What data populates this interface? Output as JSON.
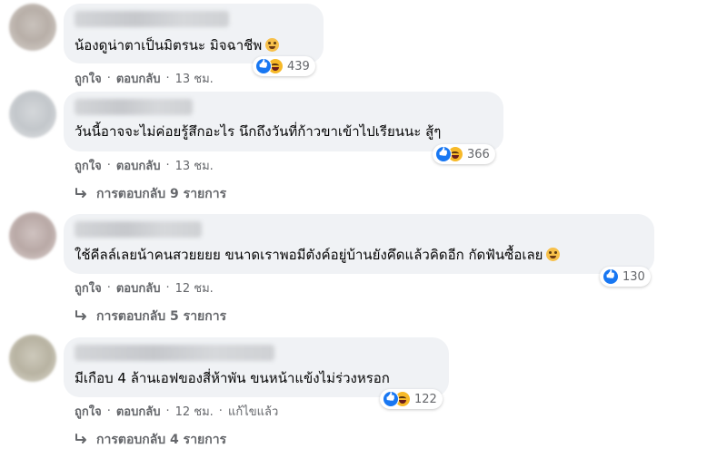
{
  "comments": [
    {
      "text": "น้องดูน่าตาเป็นมิตรนะ มิจฉาชีพ",
      "reaction_count": "439",
      "like_label": "ถูกใจ",
      "reply_label": "ตอบกลับ",
      "time": "13 ชม.",
      "edited": "",
      "replies": ""
    },
    {
      "text": "วันนี้อาจจะไม่ค่อยรู้สึกอะไร นึกถึงวันที่ก้าวขาเข้าไปเรียนนะ สู้ๆ",
      "reaction_count": "366",
      "like_label": "ถูกใจ",
      "reply_label": "ตอบกลับ",
      "time": "13 ชม.",
      "edited": "",
      "replies": "การตอบกลับ 9 รายการ"
    },
    {
      "text": "ใช้คีลล์เลยน้าคนสวยยยย ขนาดเราพอมีตังค์อยู่บ้านยังคึดแล้วคิดอีก กัดฟันซื้อเลย",
      "reaction_count": "130",
      "like_label": "ถูกใจ",
      "reply_label": "ตอบกลับ",
      "time": "12 ชม.",
      "edited": "",
      "replies": "การตอบกลับ 5 รายการ"
    },
    {
      "text": "มีเกือบ 4 ล้านเอฟของสี่ห้าพัน ขนหน้าแข้งไม่ร่วงหรอก",
      "reaction_count": "122",
      "like_label": "ถูกใจ",
      "reply_label": "ตอบกลับ",
      "time": "12 ชม.",
      "edited": "แก้ไขแล้ว",
      "replies": "การตอบกลับ 4 รายการ"
    }
  ],
  "icons": {
    "like": "like-reaction-icon",
    "haha": "haha-reaction-icon",
    "reply_arrow": "reply-arrow-icon",
    "inline_emoji": "emoji-icon"
  },
  "colors": {
    "bubble": "#f0f2f5",
    "meta_text": "#65676b",
    "like_blue": "#1877f2",
    "haha_yellow": "#f7b928"
  }
}
